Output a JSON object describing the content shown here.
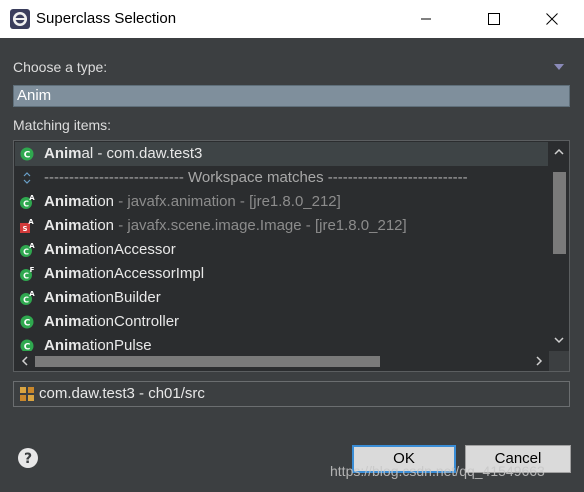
{
  "window": {
    "title": "Superclass Selection",
    "controls": [
      "minimize-icon",
      "maximize-icon",
      "close-icon"
    ]
  },
  "choose_type": {
    "label": "Choose a type:",
    "value": "Anim"
  },
  "matching": {
    "label": "Matching items:",
    "rows": [
      {
        "icon": "class-icon",
        "bold": "Anim",
        "rest": "al",
        "qualifier": " - com.daw.test3",
        "qualifier_dim": false,
        "selected": true
      },
      {
        "icon": "separator-icon",
        "bold": "",
        "rest": "",
        "qualifier": "---------------------------- Workspace matches ----------------------------",
        "qualifier_dim": false,
        "separator": true
      },
      {
        "icon": "abstract-class-icon",
        "bold": "Anim",
        "rest": "ation",
        "qualifier": " - javafx.animation - [jre1.8.0_212]",
        "qualifier_dim": true
      },
      {
        "icon": "static-abstract-class-icon",
        "bold": "Anim",
        "rest": "ation",
        "qualifier": " - javafx.scene.image.Image - [jre1.8.0_212]",
        "qualifier_dim": true
      },
      {
        "icon": "abstract-class-icon",
        "bold": "Anim",
        "rest": "ationAccessor",
        "qualifier": "",
        "qualifier_dim": false
      },
      {
        "icon": "final-class-icon",
        "bold": "Anim",
        "rest": "ationAccessorImpl",
        "qualifier": "",
        "qualifier_dim": false
      },
      {
        "icon": "abstract-class-icon",
        "bold": "Anim",
        "rest": "ationBuilder",
        "qualifier": "",
        "qualifier_dim": false
      },
      {
        "icon": "class-icon",
        "bold": "Anim",
        "rest": "ationController",
        "qualifier": "",
        "qualifier_dim": false
      },
      {
        "icon": "class-icon",
        "bold": "Anim",
        "rest": "ationPulse",
        "qualifier": "",
        "qualifier_dim": false
      }
    ]
  },
  "package": {
    "text": "com.daw.test3 - ch01/src"
  },
  "buttons": {
    "ok": "OK",
    "cancel": "Cancel"
  },
  "watermark": "https://blog.csdn.net/qq_41549663",
  "colors": {
    "background": "#3c3f41",
    "list_background": "#2b2d2f",
    "search_highlight": "#7f8f9c",
    "class_green": "#2fa84f",
    "default_button_border": "#3a8dd6"
  }
}
